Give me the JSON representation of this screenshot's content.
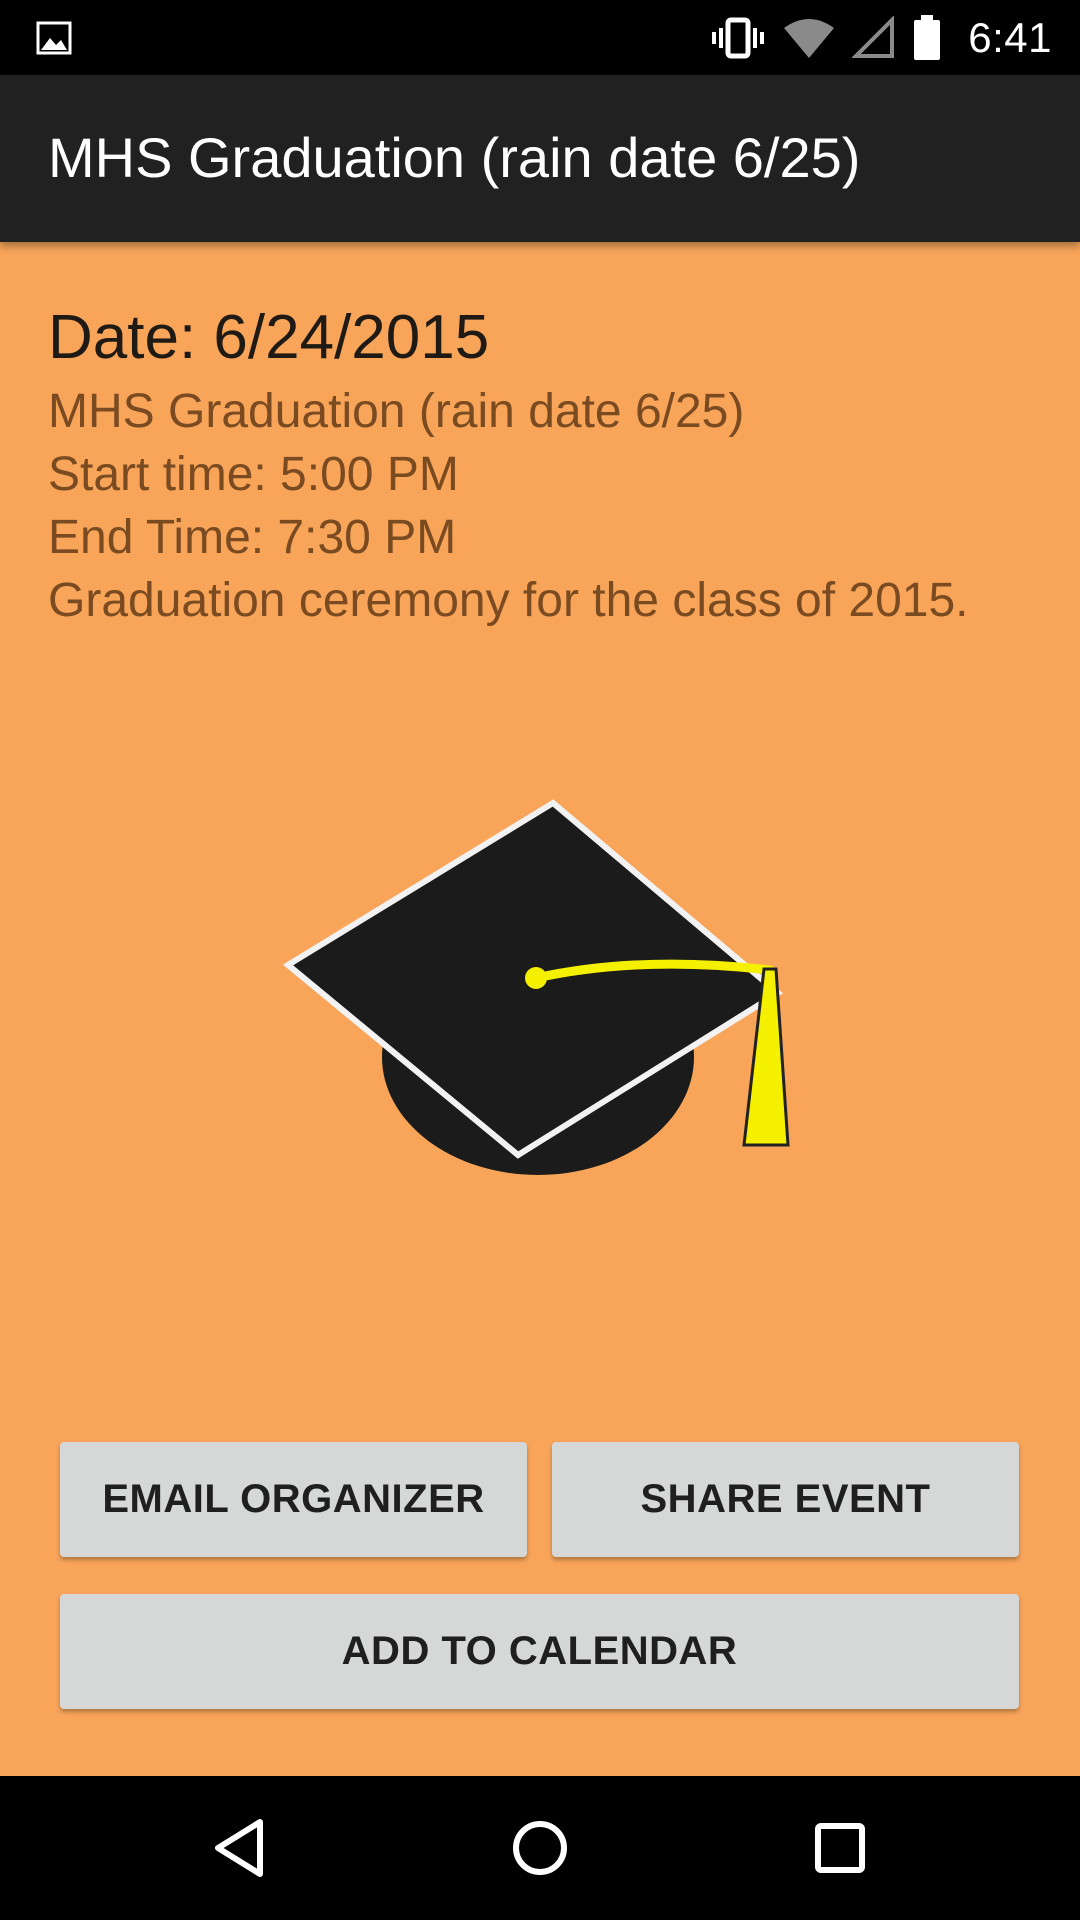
{
  "status_bar": {
    "time": "6:41",
    "icons": [
      "gallery-icon",
      "vibrate-icon",
      "wifi-icon",
      "signal-icon",
      "battery-icon"
    ]
  },
  "toolbar": {
    "title": "MHS Graduation (rain date 6/25)"
  },
  "event": {
    "date_line": "Date: 6/24/2015",
    "name": "MHS Graduation (rain date 6/25)",
    "start_time": "Start time: 5:00 PM",
    "end_time": "End Time: 7:30 PM",
    "description": "Graduation ceremony for the class of 2015.",
    "image": "graduation-cap-icon"
  },
  "buttons": {
    "email_organizer": "EMAIL ORGANIZER",
    "share_event": "SHARE EVENT",
    "add_to_calendar": "ADD TO CALENDAR"
  },
  "nav_bar": {
    "icons": [
      "back-icon",
      "home-icon",
      "recents-icon"
    ]
  },
  "colors": {
    "background": "#f8a55a",
    "toolbar": "#212121",
    "button": "#d6d7d7",
    "detail_text": "#7a4a20",
    "tassel": "#f5f000"
  }
}
